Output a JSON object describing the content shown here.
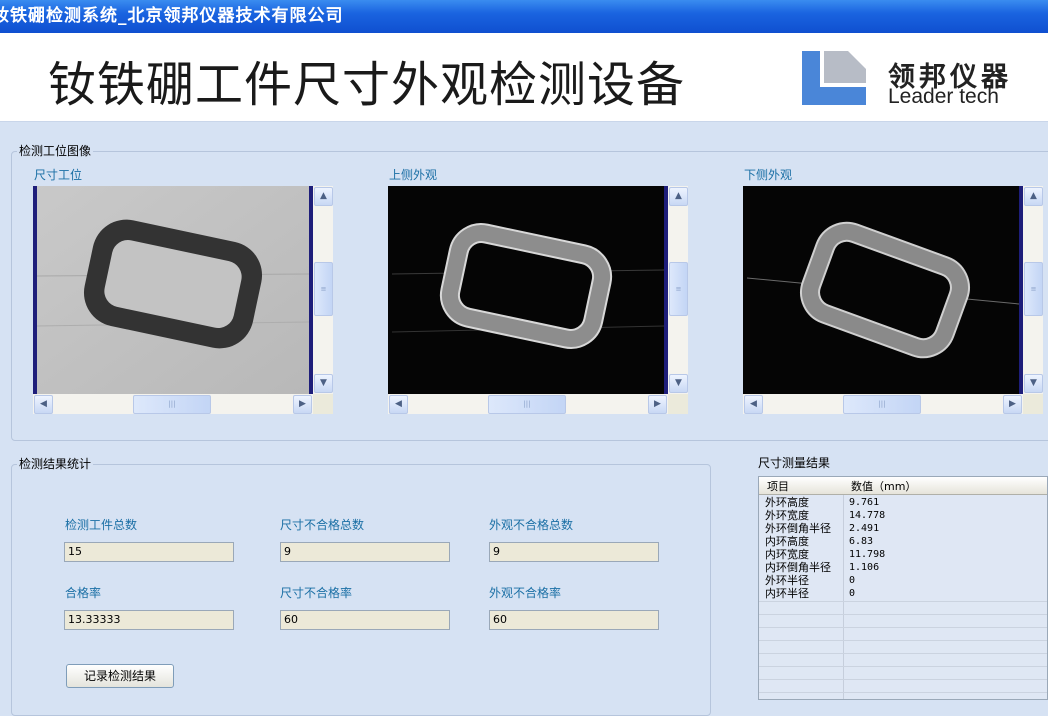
{
  "window": {
    "title": "钕铁硼检测系统_北京领邦仪器技术有限公司"
  },
  "banner": {
    "title": "钕铁硼工件尺寸外观检测设备",
    "logo_cn": "领邦仪器",
    "logo_en": "Leader tech"
  },
  "camera_group": {
    "legend": "检测工位图像",
    "views": [
      {
        "label": "尺寸工位"
      },
      {
        "label": "上侧外观"
      },
      {
        "label": "下侧外观"
      }
    ]
  },
  "stats": {
    "legend": "检测结果统计",
    "total_label": "检测工件总数",
    "total_value": "15",
    "size_fail_label": "尺寸不合格总数",
    "size_fail_value": "9",
    "appearance_fail_label": "外观不合格总数",
    "appearance_fail_value": "9",
    "pass_rate_label": "合格率",
    "pass_rate_value": "13.33333",
    "size_fail_rate_label": "尺寸不合格率",
    "size_fail_rate_value": "60",
    "appearance_fail_rate_label": "外观不合格率",
    "appearance_fail_rate_value": "60",
    "record_button": "记录检测结果"
  },
  "results": {
    "title": "尺寸测量结果",
    "col_item": "项目",
    "col_value": "数值（mm）",
    "rows": [
      {
        "item": "外环高度",
        "value": "9.761"
      },
      {
        "item": "外环宽度",
        "value": "14.778"
      },
      {
        "item": "外环倒角半径",
        "value": "2.491"
      },
      {
        "item": "内环高度",
        "value": "6.83"
      },
      {
        "item": "内环宽度",
        "value": "11.798"
      },
      {
        "item": "内环倒角半径",
        "value": "1.106"
      },
      {
        "item": "外环半径",
        "value": "0"
      },
      {
        "item": "内环半径",
        "value": "0"
      }
    ]
  },
  "colors": {
    "titlebar": "#1a64e0",
    "background": "#d6e2f3",
    "label_blue": "#1a6fa5",
    "logo_blue": "#4a86d8"
  }
}
